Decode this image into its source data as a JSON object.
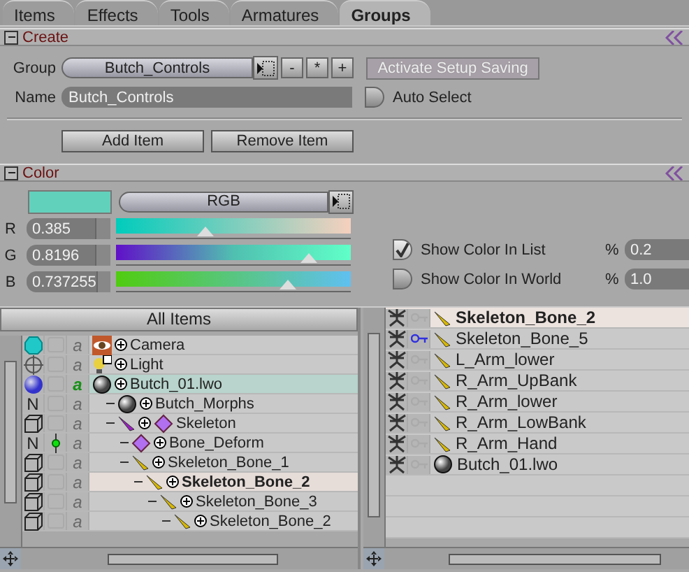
{
  "tabs": [
    {
      "label": "Items",
      "selected": false
    },
    {
      "label": "Effects",
      "selected": false
    },
    {
      "label": "Tools",
      "selected": false
    },
    {
      "label": "Armatures",
      "selected": false
    },
    {
      "label": "Groups",
      "selected": true
    }
  ],
  "create": {
    "title": "Create",
    "expanded": true,
    "group_label": "Group",
    "group_value": "Butch_Controls",
    "group_buttons": [
      "-",
      "*",
      "+"
    ],
    "activate_button": {
      "label": "Activate Setup Saving",
      "disabled": true
    },
    "name_label": "Name",
    "name_value": "Butch_Controls",
    "auto_select": {
      "label": "Auto Select",
      "checked": false
    },
    "buttons": [
      "Add Item",
      "Remove Item"
    ]
  },
  "color": {
    "title": "Color",
    "expanded": true,
    "mode": "RGB",
    "channels": [
      {
        "label": "R",
        "value": "0.385",
        "level": 0.38
      },
      {
        "label": "G",
        "value": "0.8196",
        "level": 0.82
      },
      {
        "label": "B",
        "value": "0.737255",
        "level": 0.73
      }
    ],
    "options": [
      {
        "label": "Show Color In List",
        "checked": true,
        "percent_label": "%",
        "percent": "0.2"
      },
      {
        "label": "Show Color In World",
        "checked": false,
        "percent_label": "%",
        "percent": "1.0"
      }
    ]
  },
  "tree": {
    "header": "All Items",
    "items": [
      {
        "name": "Camera",
        "kind": "camera",
        "view": {
          "kind": "gem"
        },
        "a_label": "a",
        "active": false,
        "selected": false
      },
      {
        "name": "Light",
        "kind": "light",
        "view": {
          "kind": "light"
        },
        "a_label": "a",
        "active": false,
        "selected": false
      },
      {
        "name": "Butch_01.lwo",
        "kind": "object",
        "view": {
          "kind": "sphere"
        },
        "a_label": "a",
        "active": true,
        "selected": false,
        "children": [
          {
            "name": "Butch_Morphs",
            "kind": "object",
            "view": {
              "kind": "text",
              "label": "N"
            },
            "a_label": "a",
            "active": false,
            "selected": false
          },
          {
            "name": "Skeleton",
            "kind": "skelegon_bone",
            "view": {
              "kind": "cube"
            },
            "a_label": "a",
            "active": false,
            "selected": false,
            "children": [
              {
                "name": "Bone_Deform",
                "kind": "skelegon",
                "view": {
                  "kind": "text",
                  "label": "N"
                },
                "pivot": true,
                "a_label": "a",
                "active": false,
                "selected": false
              },
              {
                "name": "Skeleton_Bone_1",
                "kind": "bone",
                "view": {
                  "kind": "cube"
                },
                "a_label": "a",
                "active": false,
                "selected": false,
                "children": [
                  {
                    "name": "Skeleton_Bone_2",
                    "kind": "bone",
                    "view": {
                      "kind": "cube"
                    },
                    "a_label": "a",
                    "active": false,
                    "selected": true,
                    "children": [
                      {
                        "name": "Skeleton_Bone_3",
                        "kind": "bone",
                        "view": {
                          "kind": "cube"
                        },
                        "a_label": "a",
                        "active": false,
                        "selected": false,
                        "children": [
                          {
                            "name": "Skeleton_Bone_2",
                            "kind": "bone",
                            "view": {
                              "kind": "cube"
                            },
                            "a_label": "a",
                            "active": false,
                            "selected": false
                          }
                        ]
                      }
                    ]
                  }
                ]
              }
            ]
          }
        ]
      }
    ]
  },
  "group_list": [
    {
      "name": "Skeleton_Bone_2",
      "kind": "bone",
      "key_on": false,
      "selected": true
    },
    {
      "name": "Skeleton_Bone_5",
      "kind": "bone",
      "key_on": true,
      "selected": false
    },
    {
      "name": "L_Arm_lower",
      "kind": "bone",
      "key_on": false,
      "selected": false
    },
    {
      "name": "R_Arm_UpBank",
      "kind": "bone",
      "key_on": false,
      "selected": false
    },
    {
      "name": "R_Arm_lower",
      "kind": "bone",
      "key_on": false,
      "selected": false
    },
    {
      "name": "R_Arm_LowBank",
      "kind": "bone",
      "key_on": false,
      "selected": false
    },
    {
      "name": "R_Arm_Hand",
      "kind": "bone",
      "key_on": false,
      "selected": false
    },
    {
      "name": "Butch_01.lwo",
      "kind": "object",
      "key_on": false,
      "selected": false
    }
  ]
}
